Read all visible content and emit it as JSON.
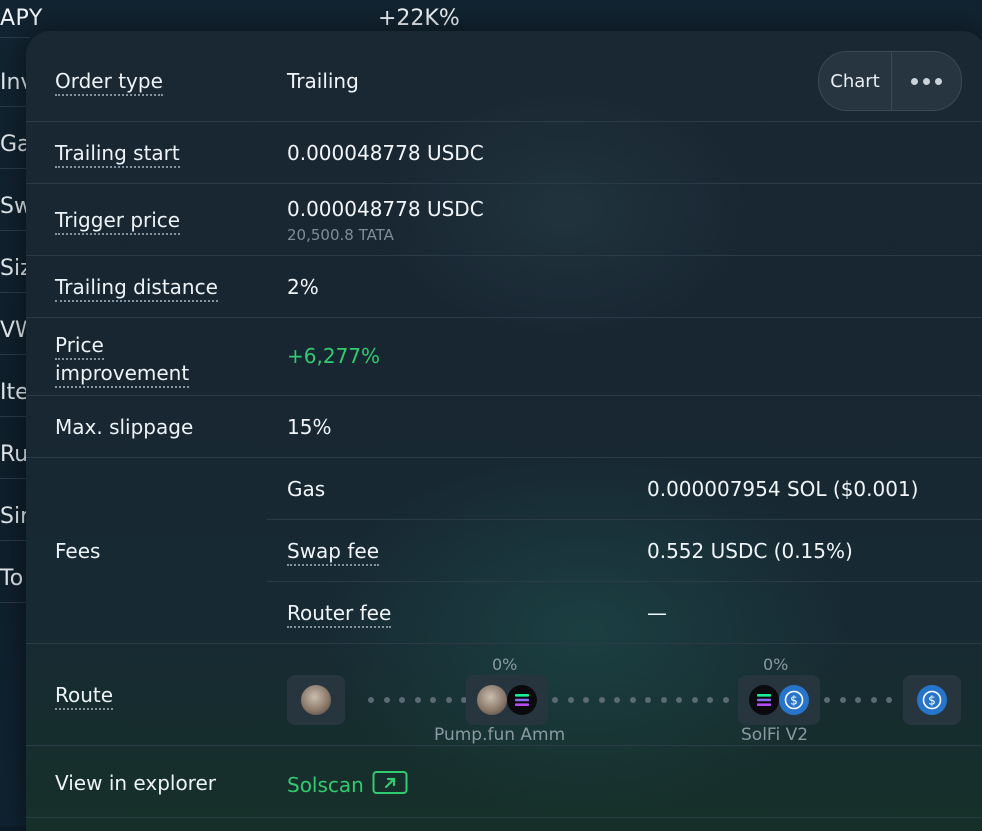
{
  "background": {
    "apy_label": "APY",
    "apy_value": "+22K%",
    "row_stubs": [
      "Inv",
      "Ga",
      "Sw",
      "Siz",
      "VW",
      "Ite",
      "Ru",
      "Sir",
      "To"
    ]
  },
  "header_actions": {
    "chart_label": "Chart",
    "more_icon": "more-horizontal-icon"
  },
  "details": {
    "order_type": {
      "label": "Order type",
      "value": "Trailing"
    },
    "trailing_start": {
      "label": "Trailing start",
      "value": "0.000048778 USDC"
    },
    "trigger_price": {
      "label": "Trigger price",
      "value": "0.000048778 USDC",
      "sub": "20,500.8 TATA"
    },
    "trailing_distance": {
      "label": "Trailing distance",
      "value": "2%"
    },
    "price_improvement": {
      "label_line1": "Price",
      "label_line2": "improvement",
      "value": "+6,277%"
    },
    "max_slippage": {
      "label": "Max. slippage",
      "value": "15%"
    },
    "fees": {
      "label": "Fees",
      "items": [
        {
          "name": "Gas",
          "value": "0.000007954 SOL ($0.001)"
        },
        {
          "name": "Swap fee",
          "value": "0.552 USDC (0.15%)"
        },
        {
          "name": "Router fee",
          "value": "—"
        }
      ]
    },
    "route": {
      "label": "Route",
      "hops": [
        {
          "percent": "0%",
          "dex": "Pump.fun Amm"
        },
        {
          "percent": "0%",
          "dex": "SolFi V2"
        }
      ]
    },
    "explorer": {
      "label": "View in explorer",
      "link": "Solscan",
      "link_icon": "external-link-icon"
    }
  },
  "colors": {
    "positive": "#31cc6f",
    "card_bg": "#182632",
    "usdc": "#2775ca"
  }
}
